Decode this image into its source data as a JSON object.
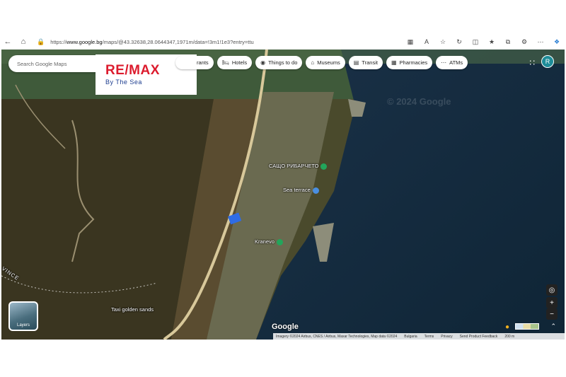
{
  "browser": {
    "url_prefix": "https://",
    "url_domain": "www.google.bg",
    "url_rest": "/maps/@43.32638,28.0644347,1971m/data=!3m1!1e3?entry=ttu"
  },
  "search": {
    "placeholder": "Search Google Maps"
  },
  "overlay_logo": {
    "brand": "RE/MAX",
    "tagline": "By The Sea"
  },
  "chips": [
    {
      "label": "rants",
      "icon": "restaurant-icon"
    },
    {
      "label": "Hotels",
      "icon": "bed-icon"
    },
    {
      "label": "Things to do",
      "icon": "camera-icon"
    },
    {
      "label": "Museums",
      "icon": "museum-icon"
    },
    {
      "label": "Transit",
      "icon": "bus-icon"
    },
    {
      "label": "Pharmacies",
      "icon": "pharmacy-icon"
    },
    {
      "label": "ATMs",
      "icon": "more-icon"
    }
  ],
  "user": {
    "avatar_letter": "R"
  },
  "places": {
    "p1": "САЩО РИБАРЧЕТО",
    "p2": "Sea terrace",
    "p3": "Kranevo",
    "p4": "Taxi golden sands"
  },
  "region_label": "VINCE",
  "watermark": "© 2024 Google",
  "layers_label": "Layers",
  "google": "Google",
  "footer": {
    "imagery": "Imagery ©2024 Airbus, CNES / Airbus, Maxar Technologies, Map data ©2024",
    "country": "Bulgaria",
    "terms": "Terms",
    "privacy": "Privacy",
    "feedback": "Send Product Feedback",
    "scale": "200 m"
  },
  "colors": {
    "brand_red": "#dc1c2e",
    "brand_blue": "#1d3d8f",
    "avatar": "#1e8c98"
  }
}
